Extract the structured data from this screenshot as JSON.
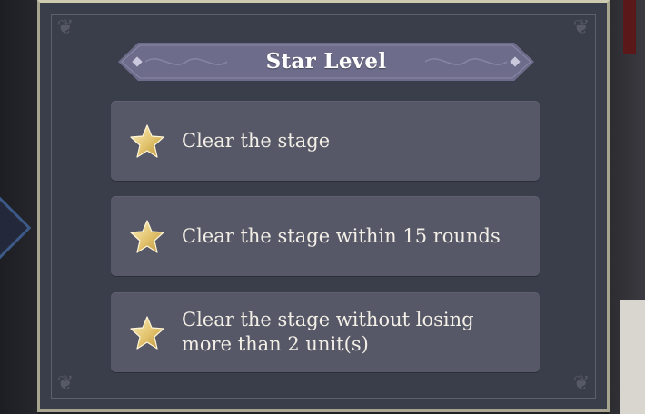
{
  "dialog": {
    "title": "Star Level",
    "objectives": [
      {
        "text": "Clear the stage",
        "icon": "star-icon"
      },
      {
        "text": "Clear the stage within 15 rounds",
        "icon": "star-icon"
      },
      {
        "text": "Clear the stage without losing more than 2 unit(s)",
        "icon": "star-icon"
      }
    ]
  },
  "colors": {
    "panel": "#3a3d4a",
    "row": "#565868",
    "banner": "#6f6e8c",
    "border": "#a7a48f",
    "star": "#e9cf7c",
    "text": "#f3efe6"
  }
}
